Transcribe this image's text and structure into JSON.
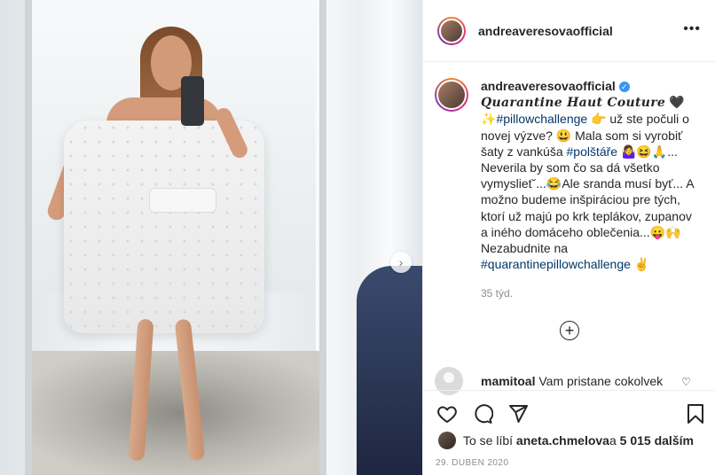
{
  "post": {
    "username": "andreaveresovaofficial",
    "more_icon": "more-horizontal-icon",
    "next_icon": "chevron-right-icon"
  },
  "caption": {
    "username": "andreaveresovaofficial",
    "title": "Quarantine Haut Couture",
    "lines": [
      "✨",
      "#pillowchallenge",
      " 👉 už ste počuli o novej výzve? 😃 Mala som si vyrobiť šaty z vankúša ",
      "#polštáře",
      " 🤷‍♀️😆🙏... Neverila by som čo sa dá všetko vymysliet˘...😂Ale sranda musí byť... A možno budeme inšpiráciou pre tých, ktorí už majú po krk teplákov, zupanov a iného domáceho oblečenia...😛🙌Nezabudnite na ",
      "#quarantinepillowchallenge",
      " ✌"
    ],
    "heart": "🖤",
    "time": "35 týd."
  },
  "comment": {
    "username": "mamitoal",
    "text": "Vam pristane cokolvek"
  },
  "likes": {
    "prefix": "To se líbí ",
    "user": "aneta.chmelova",
    "middle": " a ",
    "count": "5 015 dalším"
  },
  "date": "29. DUBEN 2020"
}
